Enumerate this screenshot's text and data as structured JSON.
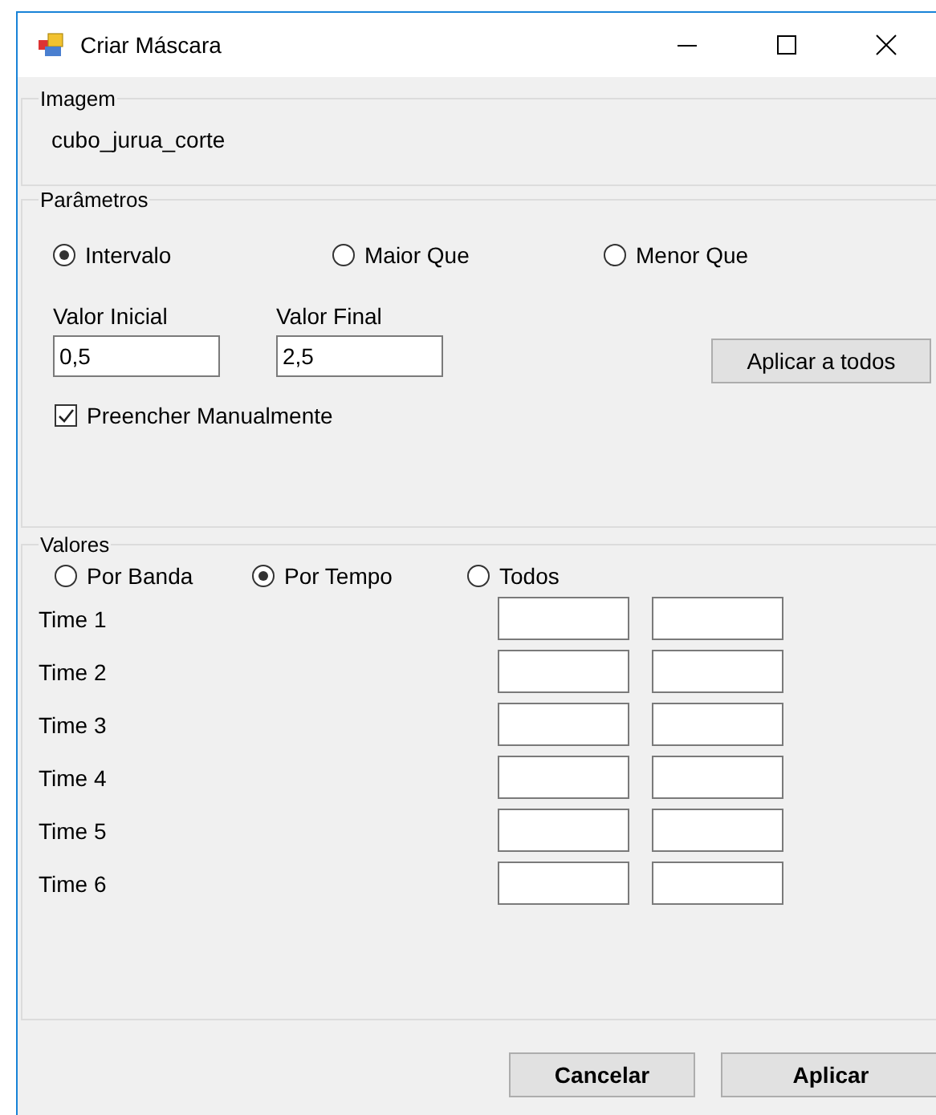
{
  "window": {
    "title": "Criar Máscara"
  },
  "image_group": {
    "title": "Imagem",
    "name": "cubo_jurua_corte"
  },
  "parameters": {
    "title": "Parâmetros",
    "modes": [
      {
        "label": "Intervalo",
        "selected": true
      },
      {
        "label": "Maior Que",
        "selected": false
      },
      {
        "label": "Menor Que",
        "selected": false
      }
    ],
    "initial": {
      "label": "Valor Inicial",
      "value": "0,5"
    },
    "final": {
      "label": "Valor Final",
      "value": "2,5"
    },
    "apply_all": "Aplicar a todos",
    "manual": {
      "label": "Preencher Manualmente",
      "checked": true
    }
  },
  "values": {
    "title": "Valores",
    "modes": [
      {
        "label": "Por Banda",
        "selected": false
      },
      {
        "label": "Por Tempo",
        "selected": true
      },
      {
        "label": "Todos",
        "selected": false
      }
    ],
    "rows": [
      {
        "label": "Time 1"
      },
      {
        "label": "Time 2"
      },
      {
        "label": "Time 3"
      },
      {
        "label": "Time 4"
      },
      {
        "label": "Time 5"
      },
      {
        "label": "Time 6"
      }
    ]
  },
  "buttons": [
    {
      "label": "Cancelar"
    },
    {
      "label": "Aplicar"
    }
  ]
}
